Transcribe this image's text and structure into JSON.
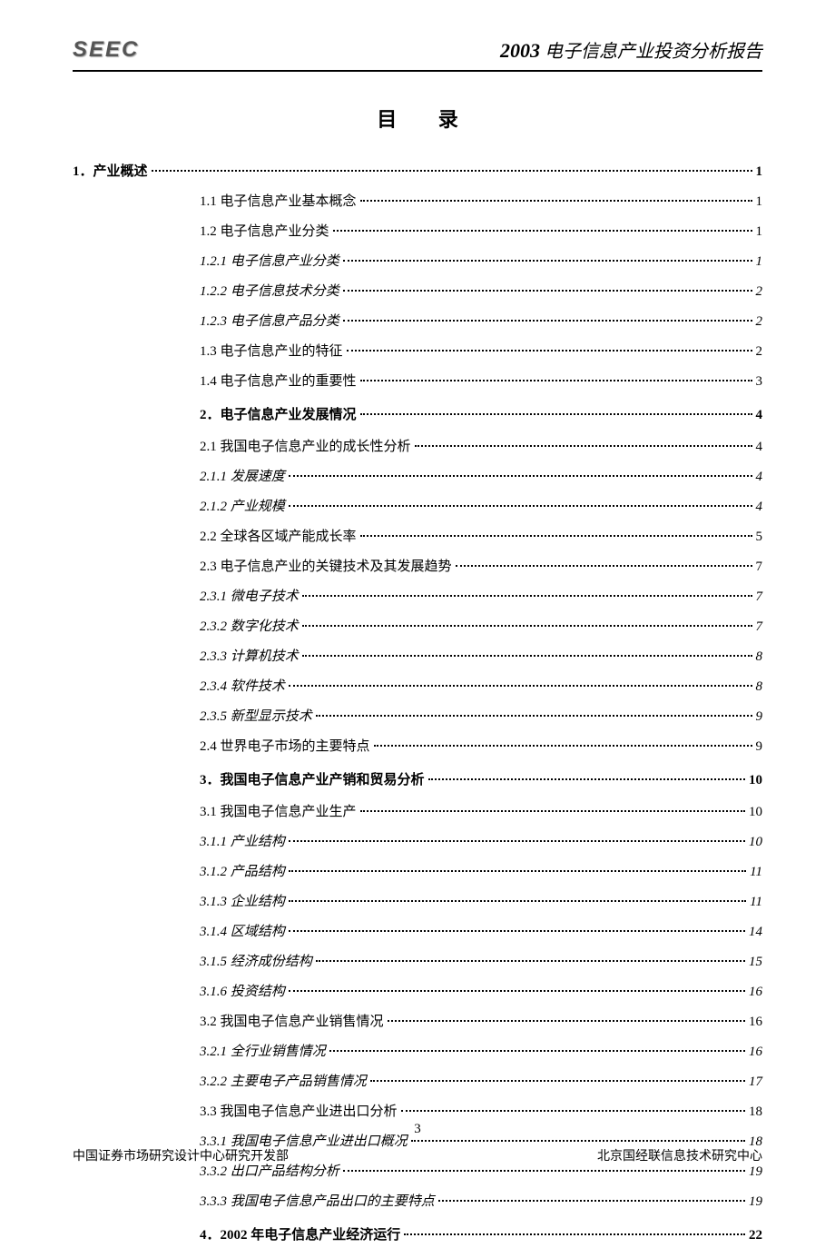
{
  "header": {
    "logo": "SEEC",
    "title_year": "2003",
    "title_text": "电子信息产业投资分析报告"
  },
  "toc_title": "目 录",
  "entries": [
    {
      "level": "level-1",
      "label": "1．产业概述",
      "page": "1"
    },
    {
      "level": "level-2",
      "label": "1.1 电子信息产业基本概念",
      "page": "1"
    },
    {
      "level": "level-2",
      "label": "1.2 电子信息产业分类",
      "page": "1"
    },
    {
      "level": "level-3",
      "label": "1.2.1 电子信息产业分类",
      "page": "1"
    },
    {
      "level": "level-3",
      "label": "1.2.2 电子信息技术分类",
      "page": "2"
    },
    {
      "level": "level-3",
      "label": "1.2.3 电子信息产品分类",
      "page": "2"
    },
    {
      "level": "level-2",
      "label": "1.3 电子信息产业的特征",
      "page": "2"
    },
    {
      "level": "level-2",
      "label": "1.4 电子信息产业的重要性",
      "page": "3"
    },
    {
      "level": "level-1-indent",
      "label": "2．电子信息产业发展情况",
      "page": "4"
    },
    {
      "level": "level-2",
      "label": "2.1 我国电子信息产业的成长性分析",
      "page": "4"
    },
    {
      "level": "level-3",
      "label": "2.1.1 发展速度",
      "page": "4"
    },
    {
      "level": "level-3",
      "label": "2.1.2 产业规模",
      "page": "4"
    },
    {
      "level": "level-2",
      "label": "2.2 全球各区域产能成长率",
      "page": "5"
    },
    {
      "level": "level-2",
      "label": "2.3 电子信息产业的关键技术及其发展趋势",
      "page": "7"
    },
    {
      "level": "level-3",
      "label": "2.3.1 微电子技术",
      "page": "7"
    },
    {
      "level": "level-3",
      "label": "2.3.2 数字化技术",
      "page": "7"
    },
    {
      "level": "level-3",
      "label": "2.3.3 计算机技术",
      "page": "8"
    },
    {
      "level": "level-3",
      "label": "2.3.4 软件技术",
      "page": "8"
    },
    {
      "level": "level-3",
      "label": "2.3.5 新型显示技术",
      "page": "9"
    },
    {
      "level": "level-2",
      "label": "2.4 世界电子市场的主要特点",
      "page": "9"
    },
    {
      "level": "level-1-indent",
      "label": "3．我国电子信息产业产销和贸易分析",
      "page": "10"
    },
    {
      "level": "level-2",
      "label": "3.1 我国电子信息产业生产",
      "page": "10"
    },
    {
      "level": "level-3",
      "label": "3.1.1 产业结构",
      "page": "10"
    },
    {
      "level": "level-3",
      "label": "3.1.2 产品结构",
      "page": "11"
    },
    {
      "level": "level-3",
      "label": "3.1.3 企业结构",
      "page": "11"
    },
    {
      "level": "level-3",
      "label": "3.1.4 区域结构",
      "page": "14"
    },
    {
      "level": "level-3",
      "label": "3.1.5 经济成份结构",
      "page": "15"
    },
    {
      "level": "level-3",
      "label": "3.1.6 投资结构",
      "page": "16"
    },
    {
      "level": "level-2",
      "label": "3.2 我国电子信息产业销售情况",
      "page": "16"
    },
    {
      "level": "level-3",
      "label": "3.2.1 全行业销售情况",
      "page": "16"
    },
    {
      "level": "level-3",
      "label": "3.2.2 主要电子产品销售情况",
      "page": "17"
    },
    {
      "level": "level-2",
      "label": "3.3 我国电子信息产业进出口分析",
      "page": "18"
    },
    {
      "level": "level-3",
      "label": "3.3.1 我国电子信息产业进出口概况",
      "page": "18"
    },
    {
      "level": "level-3",
      "label": "3.3.2 出口产品结构分析",
      "page": "19"
    },
    {
      "level": "level-3",
      "label": "3.3.3 我国电子信息产品出口的主要特点",
      "page": "19"
    },
    {
      "level": "level-1-indent",
      "label": "4．2002 年电子信息产业经济运行",
      "page": "22"
    }
  ],
  "page_number": "3",
  "footer": {
    "left": "中国证券市场研究设计中心研究开发部",
    "right": "北京国经联信息技术研究中心"
  }
}
